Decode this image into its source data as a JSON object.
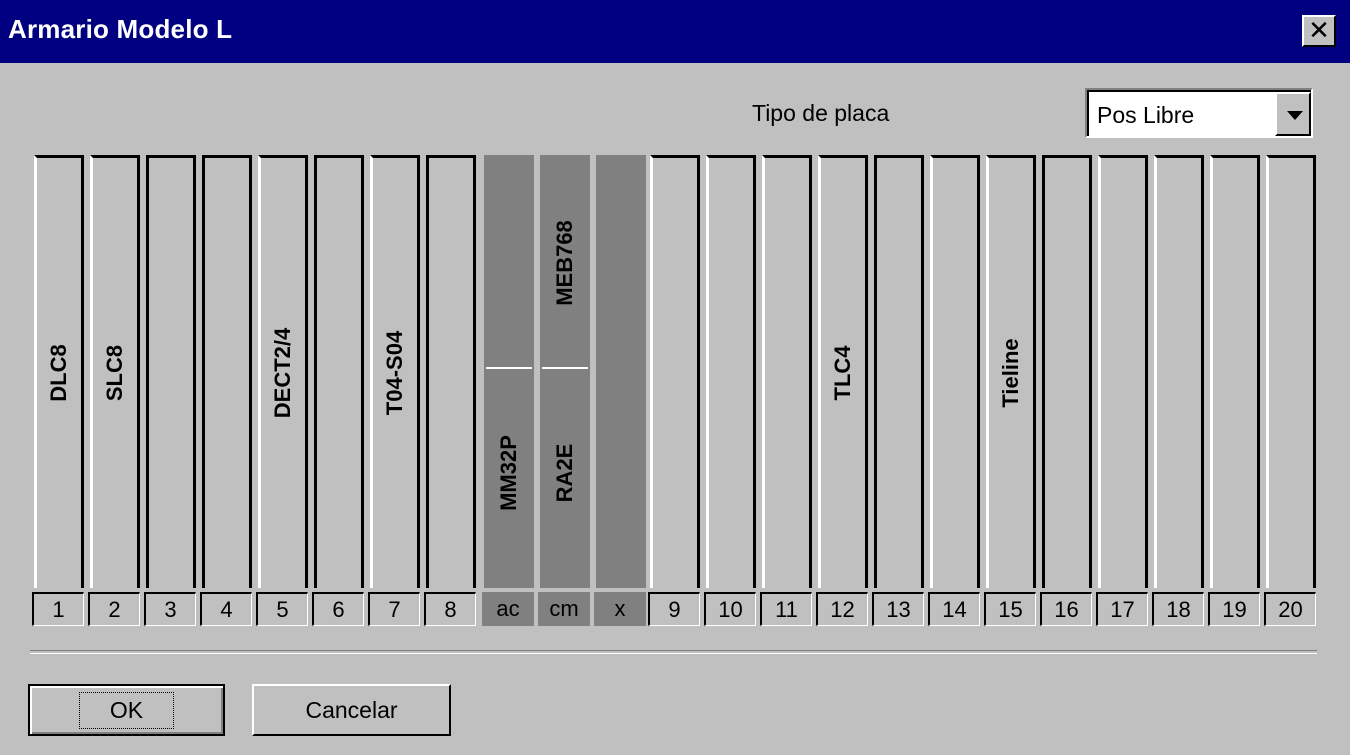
{
  "window": {
    "title": "Armario Modelo L"
  },
  "header": {
    "tipo_label": "Tipo de placa",
    "tipo_value": "Pos Libre"
  },
  "slots": [
    {
      "num": "1",
      "label": "DLC8"
    },
    {
      "num": "2",
      "label": "SLC8"
    },
    {
      "num": "3",
      "label": ""
    },
    {
      "num": "4",
      "label": ""
    },
    {
      "num": "5",
      "label": "DECT2/4"
    },
    {
      "num": "6",
      "label": ""
    },
    {
      "num": "7",
      "label": "T04-S04"
    },
    {
      "num": "8",
      "label": ""
    },
    {
      "num": "ac",
      "top_label": "",
      "bottom_label": "MM32P"
    },
    {
      "num": "cm",
      "top_label": "MEB768",
      "bottom_label": "RA2E"
    },
    {
      "num": "x",
      "label": ""
    },
    {
      "num": "9",
      "label": ""
    },
    {
      "num": "10",
      "label": ""
    },
    {
      "num": "11",
      "label": ""
    },
    {
      "num": "12",
      "label": "TLC4"
    },
    {
      "num": "13",
      "label": ""
    },
    {
      "num": "14",
      "label": ""
    },
    {
      "num": "15",
      "label": "Tieline"
    },
    {
      "num": "16",
      "label": ""
    },
    {
      "num": "17",
      "label": ""
    },
    {
      "num": "18",
      "label": ""
    },
    {
      "num": "19",
      "label": ""
    },
    {
      "num": "20",
      "label": ""
    }
  ],
  "buttons": {
    "ok": "OK",
    "cancel": "Cancelar"
  }
}
